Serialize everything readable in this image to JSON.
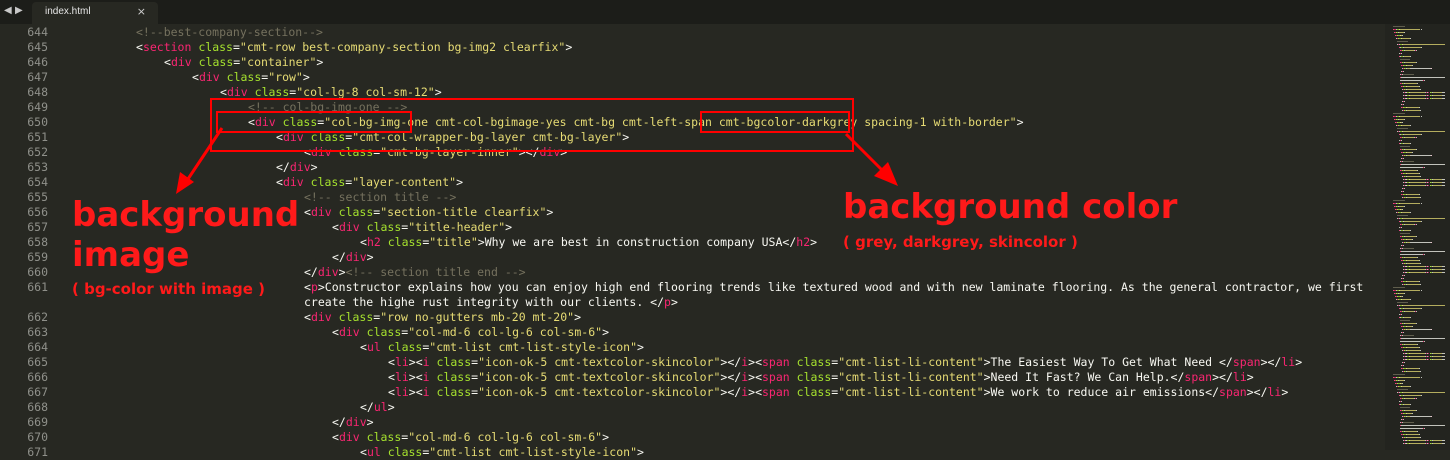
{
  "tab": {
    "filename": "index.html",
    "close_glyph": "×"
  },
  "nav": {
    "back_glyph": "◀",
    "forward_glyph": "▶"
  },
  "annotations": {
    "bg_image_title_1": "background",
    "bg_image_title_2": "image",
    "bg_image_subtitle": "( bg-color with image )",
    "bg_color_title": "background color",
    "bg_color_subtitle": "( grey, darkgrey, skincolor )",
    "color": "#ff0000"
  },
  "theme": {
    "background": "#272822",
    "tag": "#f92672",
    "attribute": "#a6e22e",
    "string": "#e6db74",
    "comment": "#75715e",
    "text": "#f8f8f2"
  },
  "lines": [
    {
      "n": "644",
      "i": 3,
      "seg": [
        [
          "c",
          "<!--best-company-section-->"
        ]
      ]
    },
    {
      "n": "645",
      "i": 3,
      "seg": [
        [
          "p",
          "<"
        ],
        [
          "t",
          "section"
        ],
        [
          "p",
          " "
        ],
        [
          "a",
          "class"
        ],
        [
          "p",
          "="
        ],
        [
          "s",
          "\"cmt-row best-company-section bg-img2 clearfix\""
        ],
        [
          "p",
          ">"
        ]
      ]
    },
    {
      "n": "646",
      "i": 4,
      "seg": [
        [
          "p",
          "<"
        ],
        [
          "t",
          "div"
        ],
        [
          "p",
          " "
        ],
        [
          "a",
          "class"
        ],
        [
          "p",
          "="
        ],
        [
          "s",
          "\"container\""
        ],
        [
          "p",
          ">"
        ]
      ]
    },
    {
      "n": "647",
      "i": 5,
      "seg": [
        [
          "p",
          "<"
        ],
        [
          "t",
          "div"
        ],
        [
          "p",
          " "
        ],
        [
          "a",
          "class"
        ],
        [
          "p",
          "="
        ],
        [
          "s",
          "\"row\""
        ],
        [
          "p",
          ">"
        ]
      ]
    },
    {
      "n": "648",
      "i": 6,
      "seg": [
        [
          "p",
          "<"
        ],
        [
          "t",
          "div"
        ],
        [
          "p",
          " "
        ],
        [
          "a",
          "class"
        ],
        [
          "p",
          "="
        ],
        [
          "s",
          "\"col-lg-8 col-sm-12\""
        ],
        [
          "p",
          ">"
        ]
      ]
    },
    {
      "n": "649",
      "i": 7,
      "seg": [
        [
          "c",
          "<!-- col-bg-img-one -->"
        ]
      ]
    },
    {
      "n": "650",
      "i": 7,
      "seg": [
        [
          "p",
          "<"
        ],
        [
          "t",
          "div"
        ],
        [
          "p",
          " "
        ],
        [
          "a",
          "class"
        ],
        [
          "p",
          "="
        ],
        [
          "s",
          "\"col-bg-img-one cmt-col-bgimage-yes cmt-bg cmt-left-span cmt-bgcolor-darkgrey spacing-1 with-border\""
        ],
        [
          "p",
          ">"
        ]
      ]
    },
    {
      "n": "651",
      "i": 8,
      "seg": [
        [
          "p",
          "<"
        ],
        [
          "t",
          "div"
        ],
        [
          "p",
          " "
        ],
        [
          "a",
          "class"
        ],
        [
          "p",
          "="
        ],
        [
          "s",
          "\"cmt-col-wrapper-bg-layer cmt-bg-layer\""
        ],
        [
          "p",
          ">"
        ]
      ]
    },
    {
      "n": "652",
      "i": 9,
      "seg": [
        [
          "p",
          "<"
        ],
        [
          "t",
          "div"
        ],
        [
          "p",
          " "
        ],
        [
          "a",
          "class"
        ],
        [
          "p",
          "="
        ],
        [
          "s",
          "\"cmt-bg-layer-inner\""
        ],
        [
          "p",
          "></"
        ],
        [
          "t",
          "div"
        ],
        [
          "p",
          ">"
        ]
      ]
    },
    {
      "n": "653",
      "i": 8,
      "seg": [
        [
          "p",
          "</"
        ],
        [
          "t",
          "div"
        ],
        [
          "p",
          ">"
        ]
      ]
    },
    {
      "n": "654",
      "i": 8,
      "seg": [
        [
          "p",
          "<"
        ],
        [
          "t",
          "div"
        ],
        [
          "p",
          " "
        ],
        [
          "a",
          "class"
        ],
        [
          "p",
          "="
        ],
        [
          "s",
          "\"layer-content\""
        ],
        [
          "p",
          ">"
        ]
      ]
    },
    {
      "n": "655",
      "i": 9,
      "seg": [
        [
          "c",
          "<!-- section title -->"
        ]
      ]
    },
    {
      "n": "656",
      "i": 9,
      "seg": [
        [
          "p",
          "<"
        ],
        [
          "t",
          "div"
        ],
        [
          "p",
          " "
        ],
        [
          "a",
          "class"
        ],
        [
          "p",
          "="
        ],
        [
          "s",
          "\"section-title clearfix\""
        ],
        [
          "p",
          ">"
        ]
      ]
    },
    {
      "n": "657",
      "i": 10,
      "seg": [
        [
          "p",
          "<"
        ],
        [
          "t",
          "div"
        ],
        [
          "p",
          " "
        ],
        [
          "a",
          "class"
        ],
        [
          "p",
          "="
        ],
        [
          "s",
          "\"title-header\""
        ],
        [
          "p",
          ">"
        ]
      ]
    },
    {
      "n": "658",
      "i": 11,
      "seg": [
        [
          "p",
          "<"
        ],
        [
          "t",
          "h2"
        ],
        [
          "p",
          " "
        ],
        [
          "a",
          "class"
        ],
        [
          "p",
          "="
        ],
        [
          "s",
          "\"title\""
        ],
        [
          "p",
          ">Why we are best in construction company USA</"
        ],
        [
          "t",
          "h2"
        ],
        [
          "p",
          ">"
        ]
      ]
    },
    {
      "n": "659",
      "i": 10,
      "seg": [
        [
          "p",
          "</"
        ],
        [
          "t",
          "div"
        ],
        [
          "p",
          ">"
        ]
      ]
    },
    {
      "n": "660",
      "i": 9,
      "seg": [
        [
          "p",
          "</"
        ],
        [
          "t",
          "div"
        ],
        [
          "p",
          ">"
        ],
        [
          "c",
          "<!-- section title end -->"
        ]
      ]
    },
    {
      "n": "661",
      "i": 9,
      "seg": [
        [
          "p",
          "<"
        ],
        [
          "t",
          "p"
        ],
        [
          "p",
          ">Constructor explains how you can enjoy high end flooring trends like textured wood and with new laminate flooring. As the general contractor, we first"
        ]
      ]
    },
    {
      "n": "",
      "i": 9,
      "seg": [
        [
          "p",
          "create the highe rust integrity with our clients. </"
        ],
        [
          "t",
          "p"
        ],
        [
          "p",
          ">"
        ]
      ]
    },
    {
      "n": "662",
      "i": 9,
      "seg": [
        [
          "p",
          "<"
        ],
        [
          "t",
          "div"
        ],
        [
          "p",
          " "
        ],
        [
          "a",
          "class"
        ],
        [
          "p",
          "="
        ],
        [
          "s",
          "\"row no-gutters mb-20 mt-20\""
        ],
        [
          "p",
          ">"
        ]
      ]
    },
    {
      "n": "663",
      "i": 10,
      "seg": [
        [
          "p",
          "<"
        ],
        [
          "t",
          "div"
        ],
        [
          "p",
          " "
        ],
        [
          "a",
          "class"
        ],
        [
          "p",
          "="
        ],
        [
          "s",
          "\"col-md-6 col-lg-6 col-sm-6\""
        ],
        [
          "p",
          ">"
        ]
      ]
    },
    {
      "n": "664",
      "i": 11,
      "seg": [
        [
          "p",
          "<"
        ],
        [
          "t",
          "ul"
        ],
        [
          "p",
          " "
        ],
        [
          "a",
          "class"
        ],
        [
          "p",
          "="
        ],
        [
          "s",
          "\"cmt-list cmt-list-style-icon\""
        ],
        [
          "p",
          ">"
        ]
      ]
    },
    {
      "n": "665",
      "i": 12,
      "seg": [
        [
          "p",
          "<"
        ],
        [
          "t",
          "li"
        ],
        [
          "p",
          "><"
        ],
        [
          "t",
          "i"
        ],
        [
          "p",
          " "
        ],
        [
          "a",
          "class"
        ],
        [
          "p",
          "="
        ],
        [
          "s",
          "\"icon-ok-5 cmt-textcolor-skincolor\""
        ],
        [
          "p",
          "></"
        ],
        [
          "t",
          "i"
        ],
        [
          "p",
          "><"
        ],
        [
          "t",
          "span"
        ],
        [
          "p",
          " "
        ],
        [
          "a",
          "class"
        ],
        [
          "p",
          "="
        ],
        [
          "s",
          "\"cmt-list-li-content\""
        ],
        [
          "p",
          ">The Easiest Way To Get What Need </"
        ],
        [
          "t",
          "span"
        ],
        [
          "p",
          "></"
        ],
        [
          "t",
          "li"
        ],
        [
          "p",
          ">"
        ]
      ]
    },
    {
      "n": "666",
      "i": 12,
      "seg": [
        [
          "p",
          "<"
        ],
        [
          "t",
          "li"
        ],
        [
          "p",
          "><"
        ],
        [
          "t",
          "i"
        ],
        [
          "p",
          " "
        ],
        [
          "a",
          "class"
        ],
        [
          "p",
          "="
        ],
        [
          "s",
          "\"icon-ok-5 cmt-textcolor-skincolor\""
        ],
        [
          "p",
          "></"
        ],
        [
          "t",
          "i"
        ],
        [
          "p",
          "><"
        ],
        [
          "t",
          "span"
        ],
        [
          "p",
          " "
        ],
        [
          "a",
          "class"
        ],
        [
          "p",
          "="
        ],
        [
          "s",
          "\"cmt-list-li-content\""
        ],
        [
          "p",
          ">Need It Fast? We Can Help.</"
        ],
        [
          "t",
          "span"
        ],
        [
          "p",
          "></"
        ],
        [
          "t",
          "li"
        ],
        [
          "p",
          ">"
        ]
      ]
    },
    {
      "n": "667",
      "i": 12,
      "seg": [
        [
          "p",
          "<"
        ],
        [
          "t",
          "li"
        ],
        [
          "p",
          "><"
        ],
        [
          "t",
          "i"
        ],
        [
          "p",
          " "
        ],
        [
          "a",
          "class"
        ],
        [
          "p",
          "="
        ],
        [
          "s",
          "\"icon-ok-5 cmt-textcolor-skincolor\""
        ],
        [
          "p",
          "></"
        ],
        [
          "t",
          "i"
        ],
        [
          "p",
          "><"
        ],
        [
          "t",
          "span"
        ],
        [
          "p",
          " "
        ],
        [
          "a",
          "class"
        ],
        [
          "p",
          "="
        ],
        [
          "s",
          "\"cmt-list-li-content\""
        ],
        [
          "p",
          ">We work to reduce air emissions</"
        ],
        [
          "t",
          "span"
        ],
        [
          "p",
          "></"
        ],
        [
          "t",
          "li"
        ],
        [
          "p",
          ">"
        ]
      ]
    },
    {
      "n": "668",
      "i": 11,
      "seg": [
        [
          "p",
          "</"
        ],
        [
          "t",
          "ul"
        ],
        [
          "p",
          ">"
        ]
      ]
    },
    {
      "n": "669",
      "i": 10,
      "seg": [
        [
          "p",
          "</"
        ],
        [
          "t",
          "div"
        ],
        [
          "p",
          ">"
        ]
      ]
    },
    {
      "n": "670",
      "i": 10,
      "seg": [
        [
          "p",
          "<"
        ],
        [
          "t",
          "div"
        ],
        [
          "p",
          " "
        ],
        [
          "a",
          "class"
        ],
        [
          "p",
          "="
        ],
        [
          "s",
          "\"col-md-6 col-lg-6 col-sm-6\""
        ],
        [
          "p",
          ">"
        ]
      ]
    },
    {
      "n": "671",
      "i": 11,
      "seg": [
        [
          "p",
          "<"
        ],
        [
          "t",
          "ul"
        ],
        [
          "p",
          " "
        ],
        [
          "a",
          "class"
        ],
        [
          "p",
          "="
        ],
        [
          "s",
          "\"cmt-list cmt-list-style-icon\""
        ],
        [
          "p",
          ">"
        ]
      ]
    }
  ]
}
